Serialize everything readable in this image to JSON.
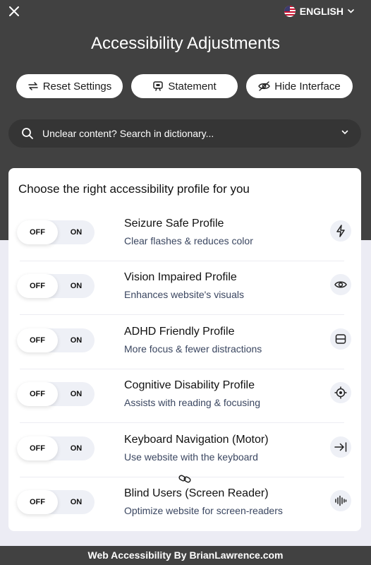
{
  "header": {
    "language_label": "ENGLISH",
    "title": "Accessibility Adjustments",
    "buttons": {
      "reset": "Reset Settings",
      "statement": "Statement",
      "hide": "Hide Interface"
    },
    "search": {
      "label": "Unclear content? Search in dictionary..."
    }
  },
  "profiles": {
    "heading": "Choose the right accessibility profile for you",
    "toggle": {
      "off": "OFF",
      "on": "ON"
    },
    "items": [
      {
        "title": "Seizure Safe Profile",
        "desc": "Clear flashes & reduces color",
        "icon": "lightning-icon"
      },
      {
        "title": "Vision Impaired Profile",
        "desc": "Enhances website's visuals",
        "icon": "eye-icon"
      },
      {
        "title": "ADHD Friendly Profile",
        "desc": "More focus & fewer distractions",
        "icon": "focus-icon"
      },
      {
        "title": "Cognitive Disability Profile",
        "desc": "Assists with reading & focusing",
        "icon": "target-icon"
      },
      {
        "title": "Keyboard Navigation (Motor)",
        "desc": "Use website with the keyboard",
        "icon": "tab-arrow-icon"
      },
      {
        "title": "Blind Users (Screen Reader)",
        "desc": "Optimize website for screen-readers",
        "icon": "audio-wave-icon"
      }
    ]
  },
  "footer": {
    "text": "Web Accessibility By BrianLawrence.com"
  },
  "colors": {
    "header_bg": "#414141",
    "search_bg": "#353535",
    "page_bg": "#ececf4",
    "toggle_track": "#eef0f6",
    "desc_text": "#3a4660"
  }
}
